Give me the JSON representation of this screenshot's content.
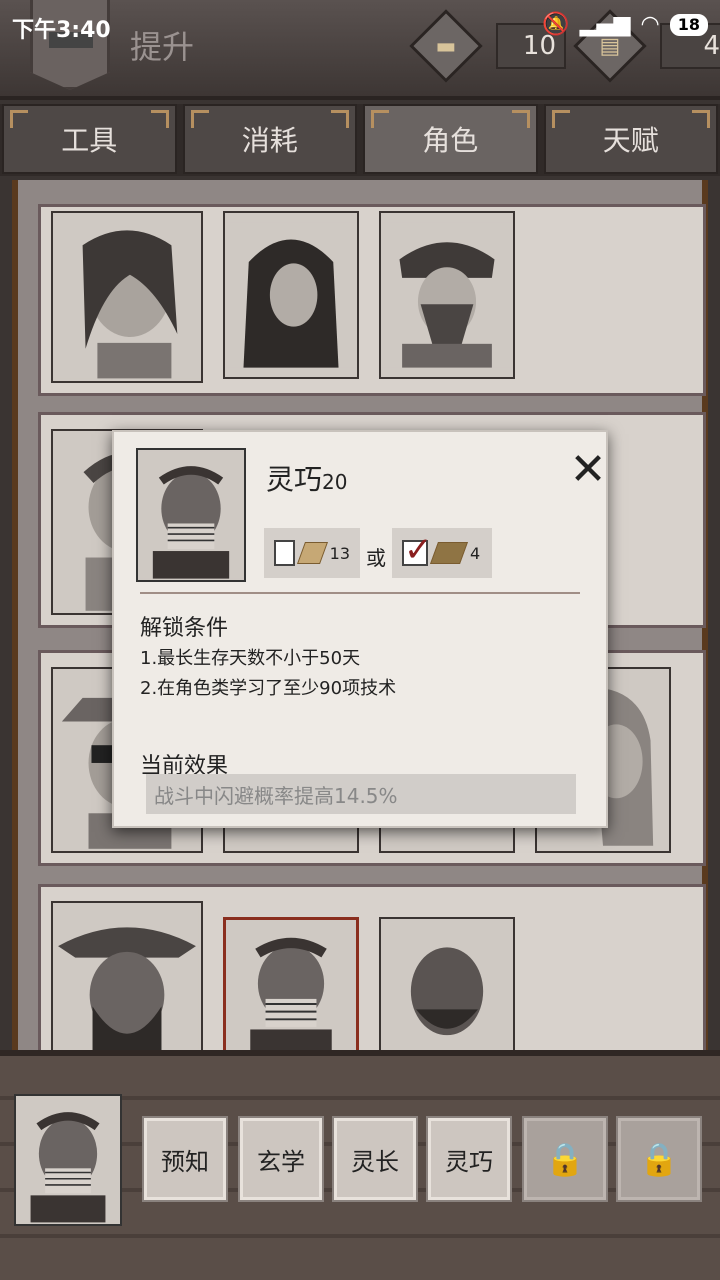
{
  "status": {
    "time": "下午3:40",
    "battery": "18"
  },
  "header": {
    "title": "提升",
    "currency1": "10",
    "currency2": "4"
  },
  "tabs": [
    {
      "label": "工具"
    },
    {
      "label": "消耗"
    },
    {
      "label": "角色",
      "active": true
    },
    {
      "label": "天赋"
    }
  ],
  "popup": {
    "name": "灵巧",
    "level": "20",
    "cost_a": "13",
    "or_text": "或",
    "cost_b": "4",
    "unlock_title": "解锁条件",
    "conditions": [
      "1.最长生存天数不小于50天",
      "2.在角色类学习了至少90项技术"
    ],
    "effect_title": "当前效果",
    "effect": "战斗中闪避概率提高14.5%"
  },
  "skills": [
    {
      "label": "预知"
    },
    {
      "label": "玄学"
    },
    {
      "label": "灵长"
    },
    {
      "label": "灵巧"
    },
    {
      "label": "",
      "locked": true
    },
    {
      "label": "",
      "locked": true
    }
  ]
}
